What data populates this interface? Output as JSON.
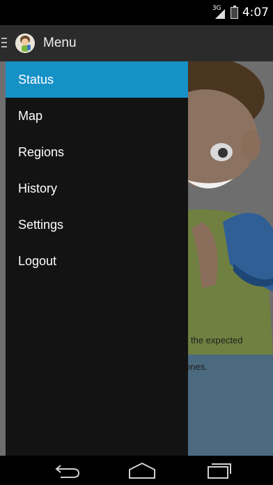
{
  "status_bar": {
    "network_label": "3G",
    "time": "4:07"
  },
  "action_bar": {
    "title": "Menu"
  },
  "drawer": {
    "items": [
      {
        "label": "Status",
        "active": true
      },
      {
        "label": "Map",
        "active": false
      },
      {
        "label": "Regions",
        "active": false
      },
      {
        "label": "History",
        "active": false
      },
      {
        "label": "Settings",
        "active": false
      },
      {
        "label": "Logout",
        "active": false
      }
    ]
  },
  "content": {
    "text_line_1": "the expected",
    "text_line_2": "ones."
  },
  "colors": {
    "drawer_active": "#1691c6",
    "drawer_background": "#131313",
    "action_bar": "#2b2b2b"
  },
  "icons": {
    "app": "boy-avatar-icon",
    "back": "back-icon",
    "home": "home-icon",
    "recents": "recents-icon"
  }
}
